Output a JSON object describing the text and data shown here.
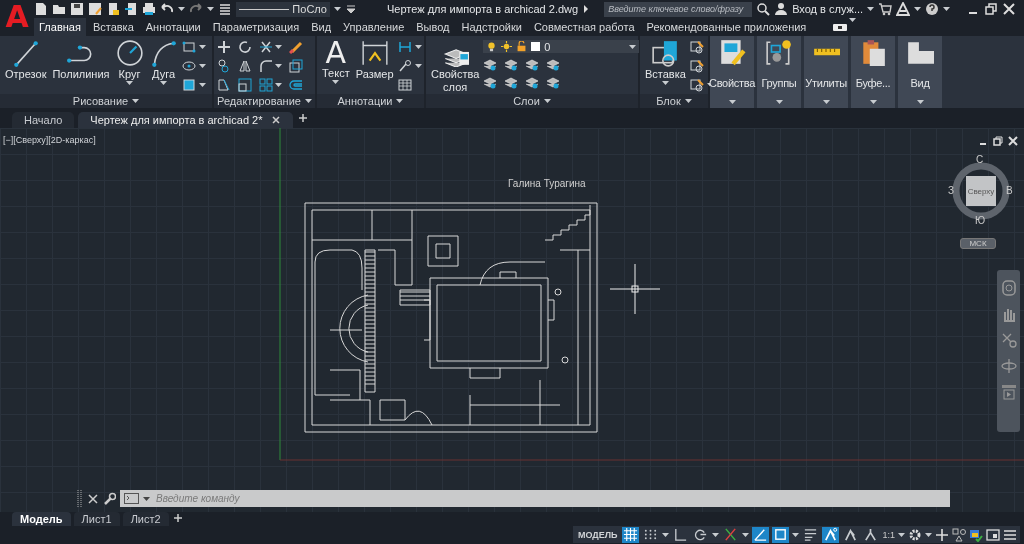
{
  "title_bar": {
    "logo": "A",
    "linetype": "ПоСло",
    "title": "Чертеж для импорта в archicad 2.dwg",
    "search": {
      "placeholder": "Введите ключевое слово/фразу"
    },
    "account": "Вход в служ..."
  },
  "ribbon_tabs": [
    {
      "label": "Главная",
      "selected": true
    },
    {
      "label": "Вставка",
      "selected": false
    },
    {
      "label": "Аннотации",
      "selected": false
    },
    {
      "label": "Параметризация",
      "selected": false
    },
    {
      "label": "Вид",
      "selected": false
    },
    {
      "label": "Управление",
      "selected": false
    },
    {
      "label": "Вывод",
      "selected": false
    },
    {
      "label": "Надстройки",
      "selected": false
    },
    {
      "label": "Совместная работа",
      "selected": false
    },
    {
      "label": "Рекомендованные приложения",
      "selected": false
    }
  ],
  "panels": [
    {
      "kind": "draw",
      "label": "Рисование",
      "buttons": [
        "Отрезок",
        "Полилиния",
        "Круг",
        "Дуга"
      ]
    },
    {
      "kind": "modify",
      "label": "Редактирование"
    },
    {
      "kind": "annotate",
      "label": "Аннотации",
      "glyph": "A",
      "buttons": [
        "Текст",
        "Размер"
      ]
    },
    {
      "kind": "layers",
      "label": "Слои",
      "buttons": [
        "Свойства слоя"
      ],
      "layer": "0"
    },
    {
      "kind": "block",
      "label": "Блок",
      "buttons": [
        "Вставка"
      ]
    },
    {
      "kind": "collapsed",
      "label": "Свойства"
    },
    {
      "kind": "collapsed",
      "label": "Группы"
    },
    {
      "kind": "collapsed",
      "label": "Утилиты"
    },
    {
      "kind": "collapsed",
      "label": "Буфе..."
    },
    {
      "kind": "collapsed",
      "label": "Вид"
    }
  ],
  "doc_tabs": [
    {
      "label": "Начало",
      "selected": false
    },
    {
      "label": "Чертеж для импорта в archicad 2*",
      "selected": true
    }
  ],
  "viewport": {
    "view_label": "[−][Сверху][2D-каркас]",
    "drawing_text": "Галина Турагина",
    "viewcube": {
      "top": "Сверху",
      "north": "С",
      "east": "В",
      "south": "Ю",
      "west": "З",
      "ucs": "МСК"
    }
  },
  "command_line": {
    "placeholder": "Введите команду"
  },
  "layout_tabs": [
    {
      "label": "Модель",
      "selected": true
    },
    {
      "label": "Лист1",
      "selected": false
    },
    {
      "label": "Лист2",
      "selected": false
    }
  ],
  "status_bar": {
    "model": "МОДЕЛЬ",
    "toggles": [
      {
        "on": true
      },
      {
        "on": false
      },
      {
        "on": false
      },
      {
        "on": false
      },
      {
        "on": false
      },
      {
        "on": true
      },
      {
        "on": true
      },
      {
        "on": false
      },
      {
        "on": true
      },
      {
        "on": false
      },
      {
        "on": false
      }
    ],
    "scale": "1:1"
  }
}
